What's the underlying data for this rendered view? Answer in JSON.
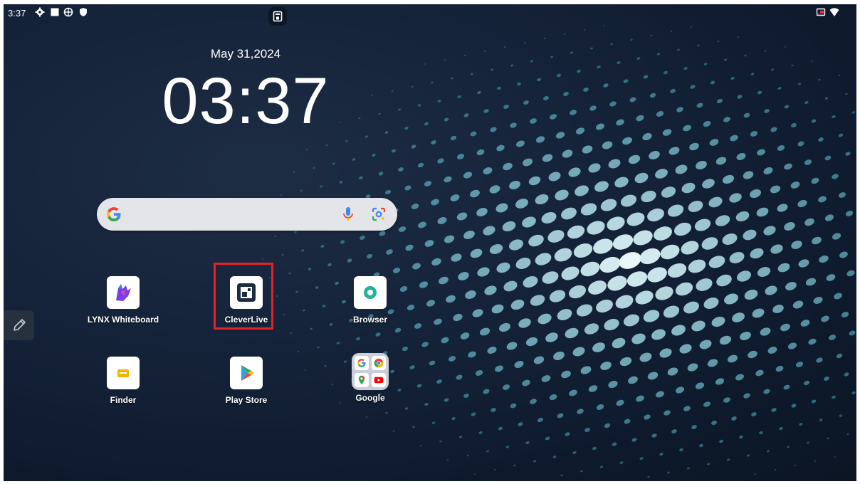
{
  "status_bar": {
    "time": "3:37",
    "left_icons": [
      "settings-gear-icon",
      "square-icon",
      "vpn-globe-icon",
      "shield-icon"
    ],
    "center_icon": "taskbar-icon",
    "right_icons": [
      "cast-icon",
      "wifi-icon"
    ]
  },
  "clock_widget": {
    "date": "May 31,2024",
    "time": "03:37"
  },
  "search_bar": {
    "icons": [
      "google-g-icon",
      "microphone-icon",
      "google-lens-icon"
    ]
  },
  "apps": [
    {
      "label": "LYNX Whiteboard",
      "icon": "lynx-whiteboard-icon"
    },
    {
      "label": "CleverLive",
      "icon": "cleverlive-icon",
      "highlighted": true
    },
    {
      "label": "Browser",
      "icon": "browser-icon"
    },
    {
      "label": "Finder",
      "icon": "finder-icon"
    },
    {
      "label": "Play Store",
      "icon": "play-store-icon"
    },
    {
      "label": "Google",
      "icon": "google-folder-icon"
    }
  ],
  "side_panel": {
    "icon": "pencil-icon"
  },
  "colors": {
    "highlight": "#e8202a",
    "background": "#15233a",
    "dot": "#8fd3e0"
  }
}
